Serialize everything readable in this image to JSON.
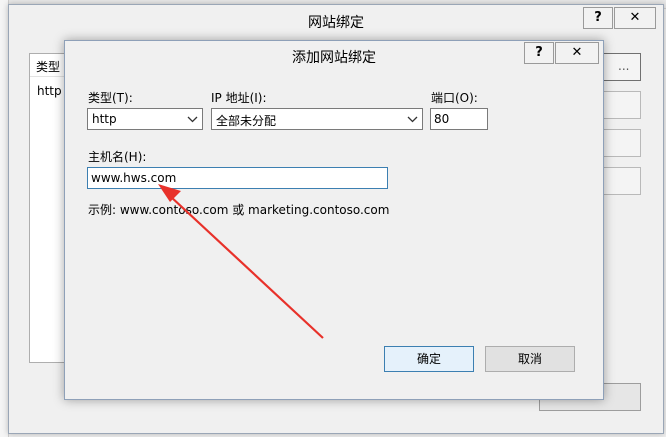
{
  "outer_dialog": {
    "title": "网站绑定",
    "help_glyph": "?",
    "close_glyph": "✕",
    "list_header_type": "类型",
    "list_row_type": "http",
    "side_button_tail": "..."
  },
  "dialog": {
    "title": "添加网站绑定",
    "help_glyph": "?",
    "close_glyph": "✕",
    "type_label": "类型(T):",
    "type_value": "http",
    "ip_label": "IP 地址(I):",
    "ip_value": "全部未分配",
    "port_label": "端口(O):",
    "port_value": "80",
    "hostname_label": "主机名(H):",
    "hostname_value": "www.hws.com",
    "example_text": "示例: www.contoso.com 或 marketing.contoso.com",
    "ok_label": "确定",
    "cancel_label": "取消"
  },
  "icons": {
    "dropdown": "chevron-down-icon",
    "annotation": "red-arrow-icon"
  },
  "colors": {
    "annotation_red": "#e8312a",
    "focus_border": "#3c7fb1"
  }
}
